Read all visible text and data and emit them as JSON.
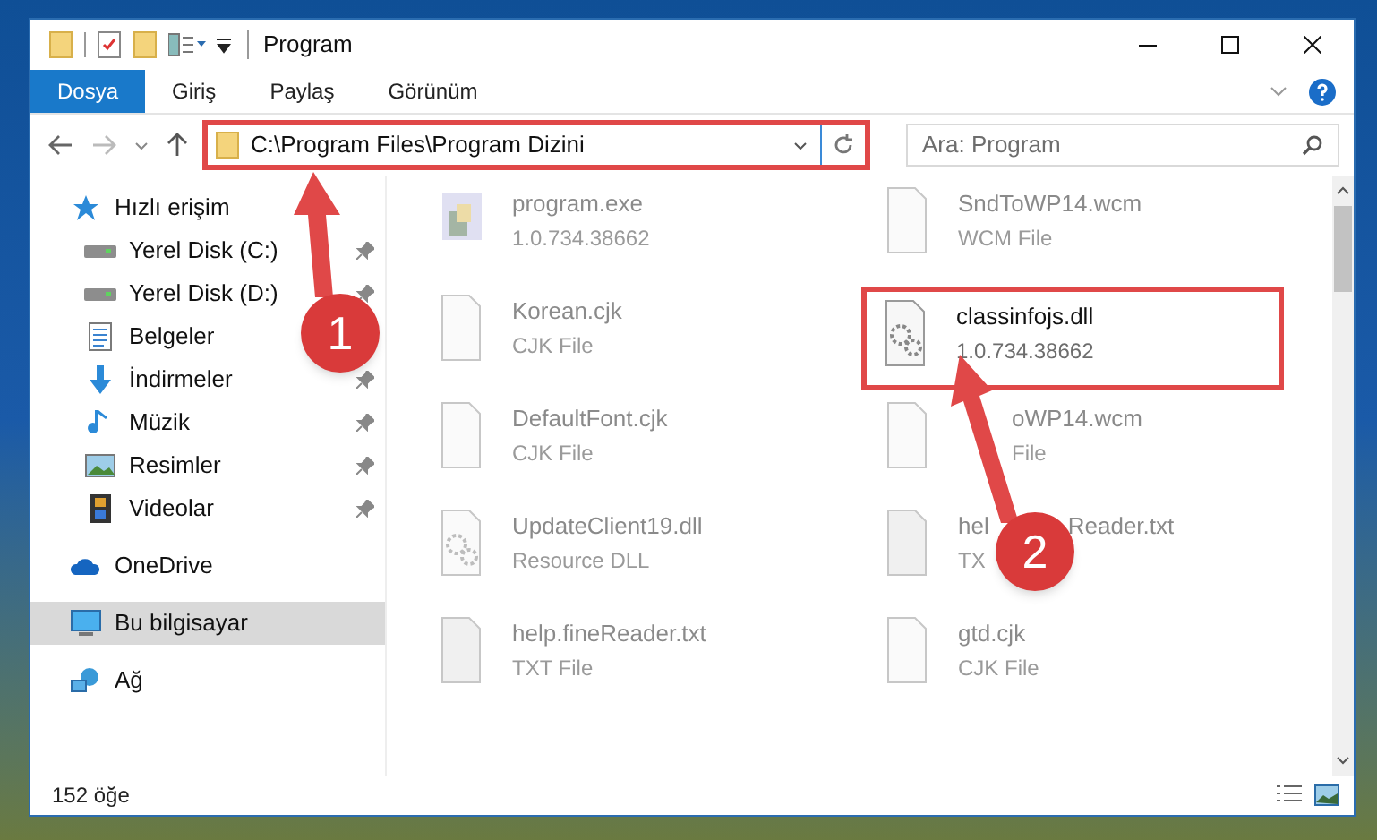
{
  "window": {
    "title": "Program"
  },
  "ribbon_tabs": [
    {
      "label": "Dosya",
      "selected": true
    },
    {
      "label": "Giriş",
      "selected": false
    },
    {
      "label": "Paylaş",
      "selected": false
    },
    {
      "label": "Görünüm",
      "selected": false
    }
  ],
  "address": {
    "path": "C:\\Program Files\\Program Dizini",
    "highlighted": true
  },
  "search": {
    "placeholder": "Ara: Program"
  },
  "sidebar": {
    "items": [
      {
        "label": "Hızlı erişim",
        "kind": "star",
        "pinned": false,
        "selected": false
      },
      {
        "label": "Yerel Disk (C:)",
        "kind": "drive",
        "pinned": true,
        "selected": false
      },
      {
        "label": "Yerel Disk (D:)",
        "kind": "drive",
        "pinned": true,
        "selected": false
      },
      {
        "label": "Belgeler",
        "kind": "document",
        "selected": false
      },
      {
        "label": "İndirmeler",
        "kind": "download",
        "pinned": true,
        "selected": false
      },
      {
        "label": "Müzik",
        "kind": "music",
        "pinned": true,
        "selected": false
      },
      {
        "label": "Resimler",
        "kind": "image",
        "pinned": true,
        "selected": false
      },
      {
        "label": "Videolar",
        "kind": "video",
        "pinned": true,
        "selected": false
      },
      {
        "label": "OneDrive",
        "kind": "cloud",
        "pinned": false,
        "selected": false
      },
      {
        "label": "Bu bilgisayar",
        "kind": "computer",
        "pinned": false,
        "selected": true
      },
      {
        "label": "Ağ",
        "kind": "network",
        "pinned": false,
        "selected": false
      }
    ]
  },
  "files": [
    {
      "name": "program.exe",
      "detail": "1.0.734.38662",
      "kind": "exe",
      "dimmed": true,
      "highlighted": false,
      "partly_covered": false
    },
    {
      "name": "SndToWP14.wcm",
      "detail": "WCM File",
      "kind": "blank",
      "dimmed": true,
      "highlighted": false,
      "partly_covered": false
    },
    {
      "name": "Korean.cjk",
      "detail": "CJK File",
      "kind": "blank",
      "dimmed": true,
      "highlighted": false,
      "partly_covered": false
    },
    {
      "name": "classinfojs.dll",
      "detail": "1.0.734.38662",
      "kind": "dll",
      "dimmed": false,
      "highlighted": true,
      "partly_covered": false
    },
    {
      "name": "DefaultFont.cjk",
      "detail": "CJK File",
      "kind": "blank",
      "dimmed": true,
      "highlighted": false,
      "partly_covered": false
    },
    {
      "name": "oWP14.wcm",
      "detail": "File",
      "kind": "blank",
      "dimmed": true,
      "highlighted": false,
      "partly_covered": true
    },
    {
      "name": "UpdateClient19.dll",
      "detail": "Resource DLL",
      "kind": "dll",
      "dimmed": true,
      "highlighted": false,
      "partly_covered": false
    },
    {
      "name_parts": [
        "hel",
        "Reader.txt"
      ],
      "detail": "TX",
      "kind": "text",
      "dimmed": true,
      "highlighted": false,
      "partly_covered": true
    },
    {
      "name": "help.fineReader.txt",
      "detail": "TXT File",
      "kind": "text",
      "dimmed": true,
      "highlighted": false,
      "partly_covered": false
    },
    {
      "name": "gtd.cjk",
      "detail": "CJK File",
      "kind": "blank",
      "dimmed": true,
      "highlighted": false,
      "partly_covered": false
    }
  ],
  "status_bar": {
    "count": "152 öğe"
  },
  "callouts": [
    {
      "number": "1"
    },
    {
      "number": "2"
    }
  ]
}
